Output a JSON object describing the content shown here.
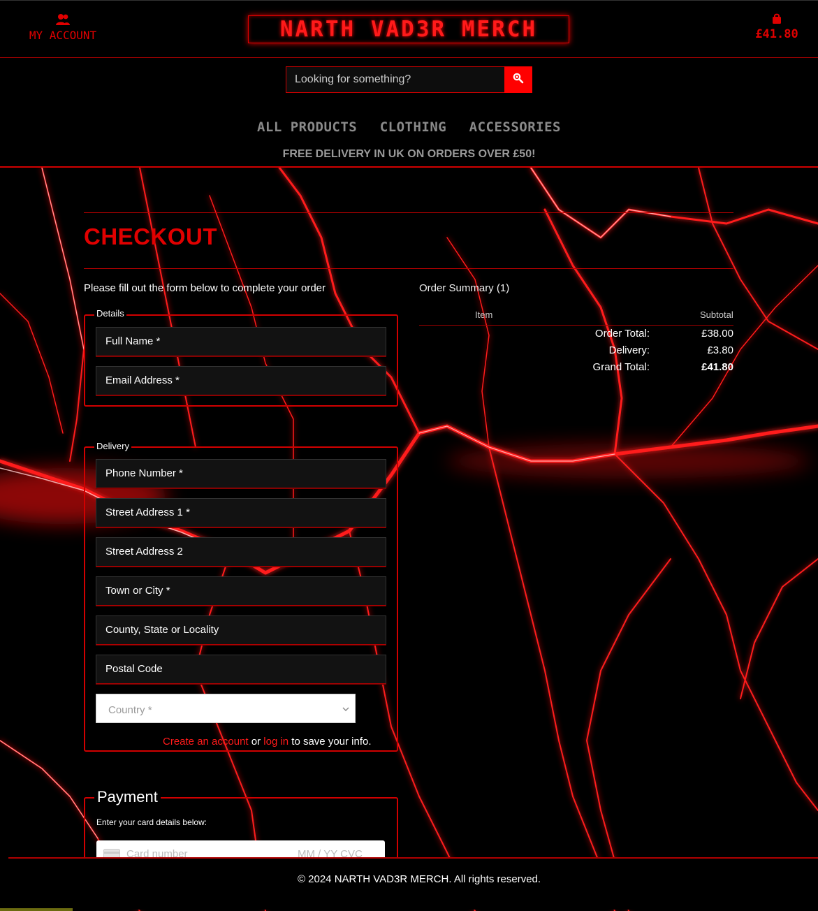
{
  "header": {
    "account_label": "MY ACCOUNT",
    "logo_text": "NARTH VAD3R MERCH",
    "basket_total": "£41.80",
    "search_placeholder": "Looking for something?",
    "nav": [
      "ALL PRODUCTS",
      "CLOTHING",
      "ACCESSORIES"
    ],
    "delivery_banner": "FREE DELIVERY IN UK ON ORDERS OVER £50!"
  },
  "checkout": {
    "title": "CHECKOUT",
    "intro": "Please fill out the form below to complete your order",
    "details": {
      "legend": "Details",
      "fields": [
        "Full Name *",
        "Email Address *"
      ]
    },
    "delivery": {
      "legend": "Delivery",
      "fields": [
        "Phone Number *",
        "Street Address 1 *",
        "Street Address 2",
        "Town or City *",
        "County, State or Locality",
        "Postal Code"
      ],
      "country_placeholder": "Country *",
      "save_note": {
        "create_link": "Create an account",
        "or": " or ",
        "login_link": "log in",
        "rest": " to save your info."
      }
    },
    "payment": {
      "legend": "Payment",
      "subtitle": "Enter your card details below:",
      "card_placeholder": "Card number",
      "card_extra": "MM / YY  CVC"
    }
  },
  "summary": {
    "title": "Order Summary (1)",
    "col_item": "Item",
    "col_subtotal": "Subtotal",
    "rows": [
      {
        "label": "Order Total:",
        "value": "£38.00"
      },
      {
        "label": "Delivery:",
        "value": "£3.80"
      },
      {
        "label": "Grand Total:",
        "value": "£41.80"
      }
    ]
  },
  "footer": {
    "text": "© 2024 NARTH VAD3R MERCH. All rights reserved."
  },
  "colors": {
    "accent": "#e00000",
    "background": "#000000"
  }
}
